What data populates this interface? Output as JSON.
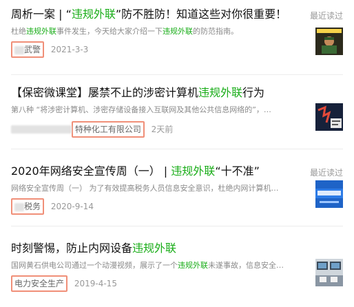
{
  "items": [
    {
      "title_parts": [
        {
          "text": "周析一案 |  “",
          "hl": false
        },
        {
          "text": "违规外联",
          "hl": true
        },
        {
          "text": "”防不胜防！知道这些对你很重要！",
          "hl": false
        }
      ],
      "summary_parts": [
        {
          "text": "杜绝",
          "hl": false
        },
        {
          "text": "违规外联",
          "hl": true
        },
        {
          "text": "事件发生，今天给大家介绍一下",
          "hl": false
        },
        {
          "text": "违规外联",
          "hl": true
        },
        {
          "text": "的防范指南。",
          "hl": false
        }
      ],
      "source": "武警",
      "date": "2021-3-3",
      "recent_badge": "最近读过"
    },
    {
      "title_parts": [
        {
          "text": "【保密微课堂】屡禁不止的涉密计算机",
          "hl": false
        },
        {
          "text": "违规外联",
          "hl": true
        },
        {
          "text": "行为",
          "hl": false
        }
      ],
      "summary_parts": [
        {
          "text": "第八种 “将涉密计算机、涉密存储设备接入互联网及其他公共信息网络的”，…",
          "hl": false
        }
      ],
      "source": "特种化工有限公司",
      "date": "2天前",
      "recent_badge": ""
    },
    {
      "title_parts": [
        {
          "text": "2020年网络安全宣传周（一） | ",
          "hl": false
        },
        {
          "text": "违规外联",
          "hl": true
        },
        {
          "text": "“十不准”",
          "hl": false
        }
      ],
      "summary_parts": [
        {
          "text": "网络安全宣传周（一） 为了有效提高税务人员信息安全意识，杜绝内网计算机…",
          "hl": false
        }
      ],
      "source": "税务",
      "date": "2020-9-14",
      "recent_badge": "最近读过"
    },
    {
      "title_parts": [
        {
          "text": "时刻警惕，防止内网设备",
          "hl": false
        },
        {
          "text": "违规外联",
          "hl": true
        }
      ],
      "summary_parts": [
        {
          "text": "国网黄石供电公司通过一个动漫视频，展示了一个",
          "hl": false
        },
        {
          "text": "违规外联",
          "hl": true
        },
        {
          "text": "未遂事故，信息安全…",
          "hl": false
        }
      ],
      "source": "电力安全生产",
      "date": "2019-4-15",
      "recent_badge": ""
    }
  ]
}
